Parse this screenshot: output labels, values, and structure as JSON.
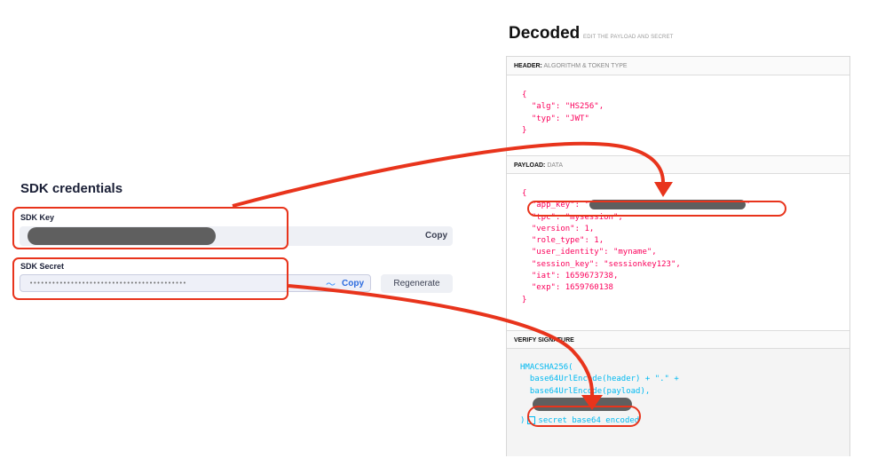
{
  "sdk": {
    "title": "SDK credentials",
    "key_label": "SDK Key",
    "key_copy": "Copy",
    "secret_label": "SDK Secret",
    "secret_masked": "••••••••••••••••••••••••••••••••••••••••••",
    "secret_copy": "Copy",
    "regenerate": "Regenerate"
  },
  "decoded": {
    "title": "Decoded",
    "subtitle": "EDIT THE PAYLOAD AND SECRET",
    "header": {
      "label": "HEADER:",
      "sublabel": "ALGORITHM & TOKEN TYPE",
      "lines": [
        "{",
        "  \"alg\": \"HS256\",",
        "  \"typ\": \"JWT\"",
        "}"
      ]
    },
    "payload": {
      "label": "PAYLOAD:",
      "sublabel": "DATA",
      "open": "{",
      "app_key_prefix": "  \"app_key\": \"",
      "app_key_suffix": "\"",
      "lines": [
        "  \"tpc\": \"mysession\",",
        "  \"version\": 1,",
        "  \"role_type\": 1,",
        "  \"user_identity\": \"myname\",",
        "  \"session_key\": \"sessionkey123\",",
        "  \"iat\": 1659673738,",
        "  \"exp\": 1659760138",
        "}"
      ]
    },
    "verify": {
      "label": "VERIFY SIGNATURE",
      "lines": [
        "HMACSHA256(",
        "  base64UrlEncode(header) + \".\" +",
        "  base64UrlEncode(payload),"
      ],
      "close": ")",
      "checkbox_label": "secret base64 encoded"
    }
  },
  "colors": {
    "annotation": "#e8341c",
    "code_pink": "#fb015b",
    "code_blue": "#00b9f1"
  }
}
